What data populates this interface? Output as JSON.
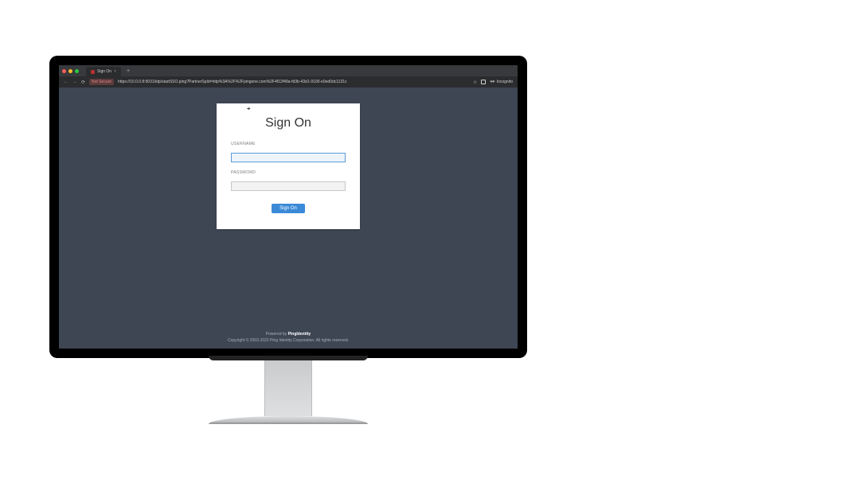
{
  "browser": {
    "tab_title": "Sign On",
    "not_secure_label": "Not Secure",
    "url": "https://10.0.0.8:9031/idp/startSSO.ping?PartnerSpId=http%3A%2F%2Fpingone.com%2F4f12f49a-fd3b-43d1-9100-e0ed0dc1131c",
    "incognito_label": "Incognito"
  },
  "page": {
    "title": "Sign On",
    "username_label": "USERNAME",
    "password_label": "PASSWORD",
    "username_value": "",
    "password_value": "",
    "submit_label": "Sign On"
  },
  "footer": {
    "powered_prefix": "Powered by ",
    "brand_name": "PingIdentity",
    "copyright": "Copyright © 2003-2022 Ping Identity Corporation. All rights reserved."
  }
}
